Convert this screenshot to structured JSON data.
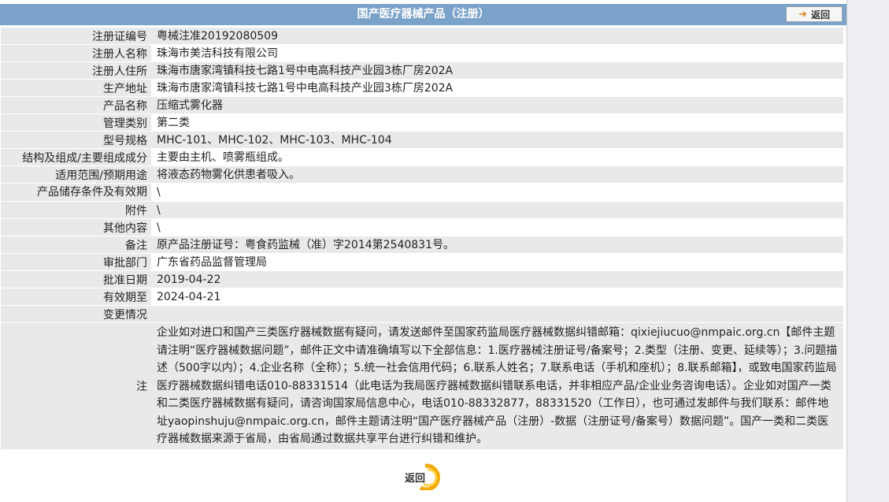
{
  "header": {
    "title": "国产医疗器械产品（注册）",
    "back_label": "返回"
  },
  "rows": [
    {
      "label": "注册证编号",
      "value": "粤械注准20192080509"
    },
    {
      "label": "注册人名称",
      "value": "珠海市美洁科技有限公司"
    },
    {
      "label": "注册人住所",
      "value": "珠海市唐家湾镇科技七路1号中电高科技产业园3栋厂房202A"
    },
    {
      "label": "生产地址",
      "value": "珠海市唐家湾镇科技七路1号中电高科技产业园3栋厂房202A"
    },
    {
      "label": "产品名称",
      "value": "压缩式雾化器"
    },
    {
      "label": "管理类别",
      "value": "第二类"
    },
    {
      "label": "型号规格",
      "value": "MHC-101、MHC-102、MHC-103、MHC-104"
    },
    {
      "label": "结构及组成/主要组成成分",
      "value": "主要由主机、喷雾瓶组成。"
    },
    {
      "label": "适用范围/预期用途",
      "value": "将液态药物雾化供患者吸入。"
    },
    {
      "label": "产品储存条件及有效期",
      "value": "\\"
    },
    {
      "label": "附件",
      "value": "\\"
    },
    {
      "label": "其他内容",
      "value": "\\"
    },
    {
      "label": "备注",
      "value": "原产品注册证号：粤食药监械（准）字2014第2540831号。"
    },
    {
      "label": "审批部门",
      "value": "广东省药品监督管理局"
    },
    {
      "label": "批准日期",
      "value": "2019-04-22"
    },
    {
      "label": "有效期至",
      "value": "2024-04-21"
    },
    {
      "label": "变更情况",
      "value": ""
    }
  ],
  "note": {
    "label": "注",
    "text": "企业如对进口和国产三类医疗器械数据有疑问，请发送邮件至国家药监局医疗器械数据纠错邮箱：qixiejiucuo@nmpaic.org.cn【邮件主题请注明“医疗器械数据问题”，邮件正文中请准确填写以下全部信息：1.医疗器械注册证号/备案号；2.类型（注册、变更、延续等）；3.问题描述（500字以内）；4.企业名称（全称）；5.统一社会信用代码；6.联系人姓名；7.联系电话（手机和座机）；8.联系邮箱】，或致电国家药监局医疗器械数据纠错电话010-88331514（此电话为我局医疗器械数据纠错联系电话，并非相应产品/企业业务咨询电话）。企业如对国产一类和二类医疗器械数据有疑问，请咨询国家局信息中心，电话010-88332877，88331520（工作日），也可通过发邮件与我们联系：邮件地址yaopinshuju@nmpaic.org.cn，邮件主题请注明“国产医疗器械产品（注册）-数据（注册证号/备案号）数据问题”。国产一类和二类医疗器械数据来源于省局，由省局通过数据共享平台进行纠错和维护。"
  },
  "footer": {
    "back_label": "返回"
  },
  "colors": {
    "header_bg": "#7ba2c8",
    "row_alt_bg": "#e9e9e9",
    "back_arrow": "#e08a1a"
  }
}
